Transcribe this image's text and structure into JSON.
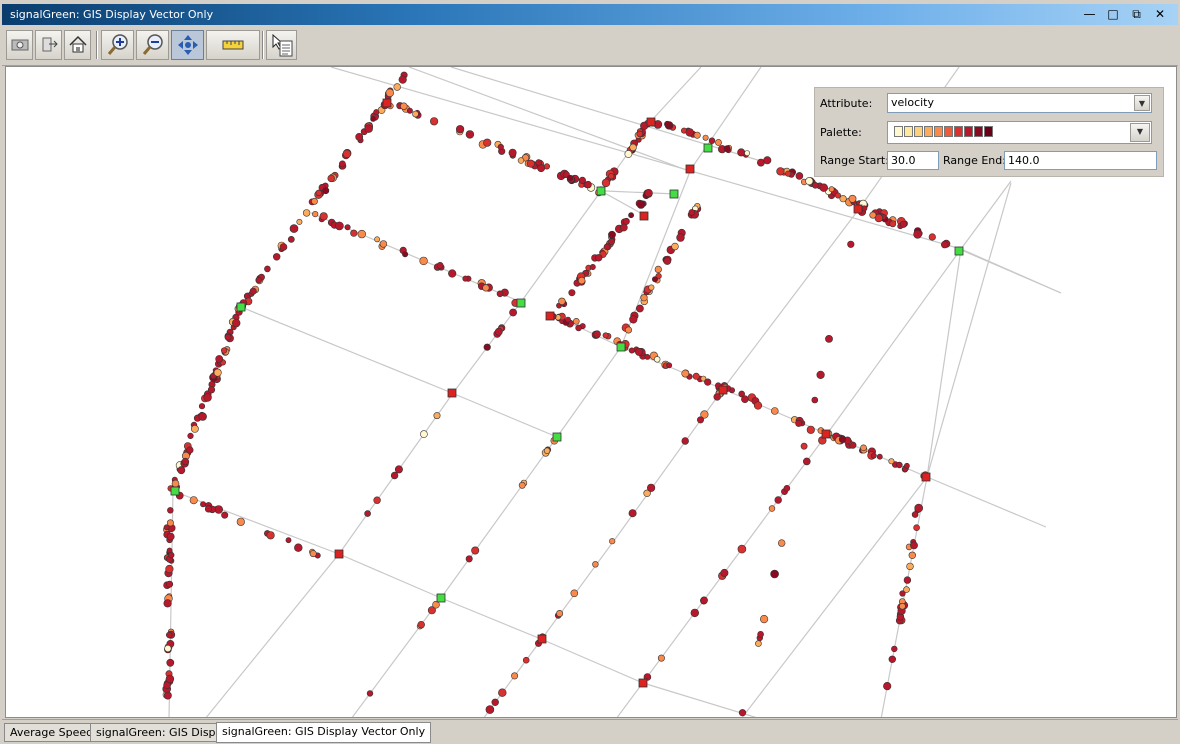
{
  "window": {
    "title": "signalGreen: GIS Display Vector Only"
  },
  "window_controls": [
    "minimize",
    "maximize",
    "restore",
    "close"
  ],
  "toolbar": {
    "buttons": [
      "screenshot-icon",
      "export-icon",
      "home-icon",
      "zoom-in-icon",
      "zoom-out-icon",
      "pan-icon",
      "ruler-icon",
      "select-icon"
    ],
    "active_tool": "pan"
  },
  "legend_panel": {
    "attribute_label": "Attribute:",
    "attribute_value": "velocity",
    "palette_label": "Palette:",
    "palette_colors": [
      "#fff8d0",
      "#ffe8a0",
      "#fdd07a",
      "#fcaa5c",
      "#f98a4c",
      "#ef5a3c",
      "#d93030",
      "#b8182c",
      "#8a0a22",
      "#6a0018"
    ],
    "range_start_label": "Range Start:",
    "range_start_value": "30.0",
    "range_end_label": "Range End:",
    "range_end_value": "140.0"
  },
  "map": {
    "colors": {
      "road": "#c8c8c8",
      "signal_green": "#44dd44",
      "signal_red": "#dd2222",
      "outline": "#333333"
    }
  },
  "tabs": [
    {
      "label": "Average Speed",
      "active": false
    },
    {
      "label": "signalGreen: GIS Display",
      "active": false
    },
    {
      "label": "signalGreen: GIS Display Vector Only",
      "active": true
    }
  ]
}
